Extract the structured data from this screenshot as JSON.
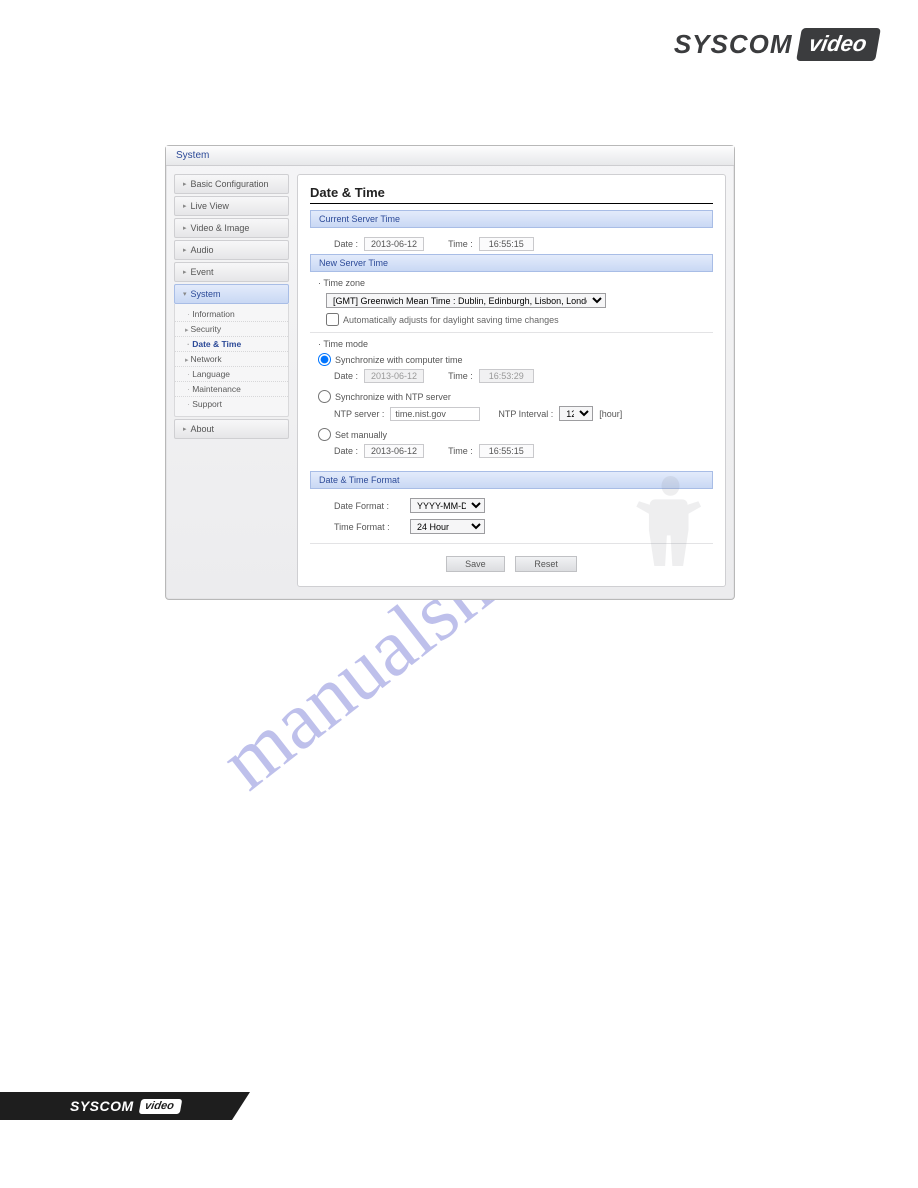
{
  "brand": {
    "name": "SYSCOM",
    "sub": "video"
  },
  "watermark": "manualshive.com",
  "window": {
    "title": "System"
  },
  "sidebar": {
    "items": [
      {
        "label": "Basic Configuration"
      },
      {
        "label": "Live View"
      },
      {
        "label": "Video & Image"
      },
      {
        "label": "Audio"
      },
      {
        "label": "Event"
      },
      {
        "label": "System"
      },
      {
        "label": "About"
      }
    ],
    "system_sub": [
      {
        "label": "Information"
      },
      {
        "label": "Security"
      },
      {
        "label": "Date & Time"
      },
      {
        "label": "Network"
      },
      {
        "label": "Language"
      },
      {
        "label": "Maintenance"
      },
      {
        "label": "Support"
      }
    ]
  },
  "content": {
    "title": "Date & Time",
    "current_hdr": "Current Server Time",
    "new_hdr": "New Server Time",
    "fmt_hdr": "Date & Time Format",
    "labels": {
      "date": "Date :",
      "time": "Time :",
      "tz": "· Time zone",
      "tz_dst": "Automatically adjusts for daylight saving time changes",
      "mode": "· Time mode",
      "sync_comp": "Synchronize with computer time",
      "sync_ntp": "Synchronize with NTP server",
      "ntp_server": "NTP server :",
      "ntp_interval": "NTP Interval :",
      "ntp_unit": "[hour]",
      "set_man": "Set manually",
      "date_fmt": "Date Format :",
      "time_fmt": "Time Format :"
    },
    "current": {
      "date": "2013-06-12",
      "time": "16:55:15"
    },
    "tz_value": "[GMT] Greenwich Mean Time : Dublin, Edinburgh, Lisbon, London",
    "comp": {
      "date": "2013-06-12",
      "time": "16:53:29"
    },
    "ntp": {
      "server": "time.nist.gov",
      "interval": "12"
    },
    "manual": {
      "date": "2013-06-12",
      "time": "16:55:15"
    },
    "date_format": "YYYY-MM-DD",
    "time_format": "24 Hour",
    "buttons": {
      "save": "Save",
      "reset": "Reset"
    }
  }
}
